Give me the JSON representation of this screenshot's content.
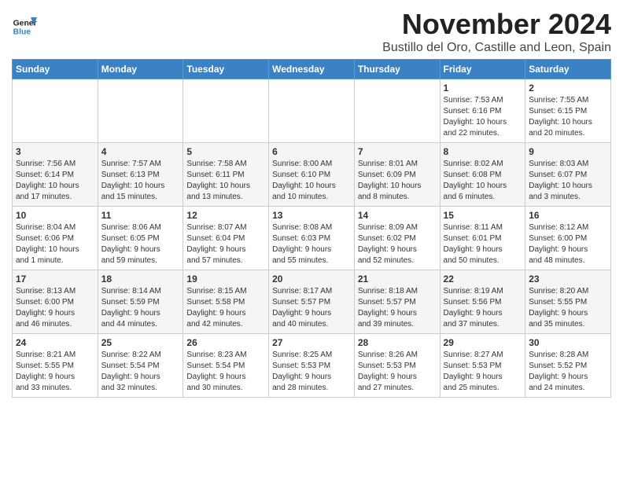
{
  "header": {
    "logo_line1": "General",
    "logo_line2": "Blue",
    "month_title": "November 2024",
    "location": "Bustillo del Oro, Castille and Leon, Spain"
  },
  "days_of_week": [
    "Sunday",
    "Monday",
    "Tuesday",
    "Wednesday",
    "Thursday",
    "Friday",
    "Saturday"
  ],
  "weeks": [
    [
      {
        "day": "",
        "info": ""
      },
      {
        "day": "",
        "info": ""
      },
      {
        "day": "",
        "info": ""
      },
      {
        "day": "",
        "info": ""
      },
      {
        "day": "",
        "info": ""
      },
      {
        "day": "1",
        "info": "Sunrise: 7:53 AM\nSunset: 6:16 PM\nDaylight: 10 hours\nand 22 minutes."
      },
      {
        "day": "2",
        "info": "Sunrise: 7:55 AM\nSunset: 6:15 PM\nDaylight: 10 hours\nand 20 minutes."
      }
    ],
    [
      {
        "day": "3",
        "info": "Sunrise: 7:56 AM\nSunset: 6:14 PM\nDaylight: 10 hours\nand 17 minutes."
      },
      {
        "day": "4",
        "info": "Sunrise: 7:57 AM\nSunset: 6:13 PM\nDaylight: 10 hours\nand 15 minutes."
      },
      {
        "day": "5",
        "info": "Sunrise: 7:58 AM\nSunset: 6:11 PM\nDaylight: 10 hours\nand 13 minutes."
      },
      {
        "day": "6",
        "info": "Sunrise: 8:00 AM\nSunset: 6:10 PM\nDaylight: 10 hours\nand 10 minutes."
      },
      {
        "day": "7",
        "info": "Sunrise: 8:01 AM\nSunset: 6:09 PM\nDaylight: 10 hours\nand 8 minutes."
      },
      {
        "day": "8",
        "info": "Sunrise: 8:02 AM\nSunset: 6:08 PM\nDaylight: 10 hours\nand 6 minutes."
      },
      {
        "day": "9",
        "info": "Sunrise: 8:03 AM\nSunset: 6:07 PM\nDaylight: 10 hours\nand 3 minutes."
      }
    ],
    [
      {
        "day": "10",
        "info": "Sunrise: 8:04 AM\nSunset: 6:06 PM\nDaylight: 10 hours\nand 1 minute."
      },
      {
        "day": "11",
        "info": "Sunrise: 8:06 AM\nSunset: 6:05 PM\nDaylight: 9 hours\nand 59 minutes."
      },
      {
        "day": "12",
        "info": "Sunrise: 8:07 AM\nSunset: 6:04 PM\nDaylight: 9 hours\nand 57 minutes."
      },
      {
        "day": "13",
        "info": "Sunrise: 8:08 AM\nSunset: 6:03 PM\nDaylight: 9 hours\nand 55 minutes."
      },
      {
        "day": "14",
        "info": "Sunrise: 8:09 AM\nSunset: 6:02 PM\nDaylight: 9 hours\nand 52 minutes."
      },
      {
        "day": "15",
        "info": "Sunrise: 8:11 AM\nSunset: 6:01 PM\nDaylight: 9 hours\nand 50 minutes."
      },
      {
        "day": "16",
        "info": "Sunrise: 8:12 AM\nSunset: 6:00 PM\nDaylight: 9 hours\nand 48 minutes."
      }
    ],
    [
      {
        "day": "17",
        "info": "Sunrise: 8:13 AM\nSunset: 6:00 PM\nDaylight: 9 hours\nand 46 minutes."
      },
      {
        "day": "18",
        "info": "Sunrise: 8:14 AM\nSunset: 5:59 PM\nDaylight: 9 hours\nand 44 minutes."
      },
      {
        "day": "19",
        "info": "Sunrise: 8:15 AM\nSunset: 5:58 PM\nDaylight: 9 hours\nand 42 minutes."
      },
      {
        "day": "20",
        "info": "Sunrise: 8:17 AM\nSunset: 5:57 PM\nDaylight: 9 hours\nand 40 minutes."
      },
      {
        "day": "21",
        "info": "Sunrise: 8:18 AM\nSunset: 5:57 PM\nDaylight: 9 hours\nand 39 minutes."
      },
      {
        "day": "22",
        "info": "Sunrise: 8:19 AM\nSunset: 5:56 PM\nDaylight: 9 hours\nand 37 minutes."
      },
      {
        "day": "23",
        "info": "Sunrise: 8:20 AM\nSunset: 5:55 PM\nDaylight: 9 hours\nand 35 minutes."
      }
    ],
    [
      {
        "day": "24",
        "info": "Sunrise: 8:21 AM\nSunset: 5:55 PM\nDaylight: 9 hours\nand 33 minutes."
      },
      {
        "day": "25",
        "info": "Sunrise: 8:22 AM\nSunset: 5:54 PM\nDaylight: 9 hours\nand 32 minutes."
      },
      {
        "day": "26",
        "info": "Sunrise: 8:23 AM\nSunset: 5:54 PM\nDaylight: 9 hours\nand 30 minutes."
      },
      {
        "day": "27",
        "info": "Sunrise: 8:25 AM\nSunset: 5:53 PM\nDaylight: 9 hours\nand 28 minutes."
      },
      {
        "day": "28",
        "info": "Sunrise: 8:26 AM\nSunset: 5:53 PM\nDaylight: 9 hours\nand 27 minutes."
      },
      {
        "day": "29",
        "info": "Sunrise: 8:27 AM\nSunset: 5:53 PM\nDaylight: 9 hours\nand 25 minutes."
      },
      {
        "day": "30",
        "info": "Sunrise: 8:28 AM\nSunset: 5:52 PM\nDaylight: 9 hours\nand 24 minutes."
      }
    ]
  ]
}
